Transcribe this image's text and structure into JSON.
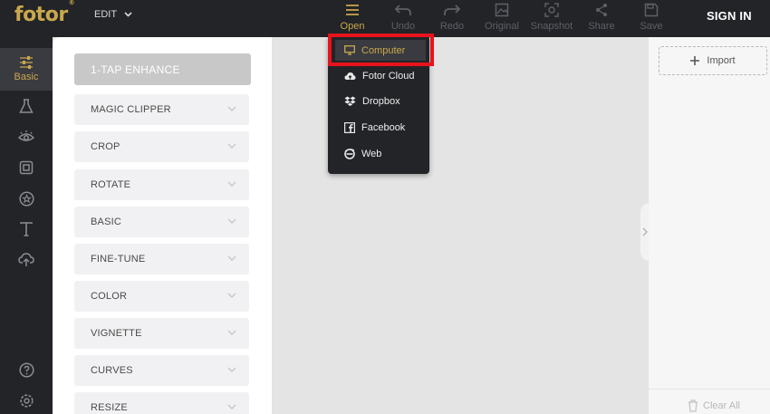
{
  "app": {
    "logo": "fotor",
    "logo_mark": "®",
    "mode_menu": "EDIT"
  },
  "toolbar": {
    "open": "Open",
    "undo": "Undo",
    "redo": "Redo",
    "original": "Original",
    "snapshot": "Snapshot",
    "share": "Share",
    "save": "Save",
    "sign_in": "SIGN IN"
  },
  "leftbar": {
    "active_label": "Basic"
  },
  "panel": {
    "enhance": "1-TAP ENHANCE",
    "items": [
      "MAGIC CLIPPER",
      "CROP",
      "ROTATE",
      "BASIC",
      "FINE-TUNE",
      "COLOR",
      "VIGNETTE",
      "CURVES",
      "RESIZE"
    ]
  },
  "open_menu": {
    "items": [
      "Computer",
      "Fotor Cloud",
      "Dropbox",
      "Facebook",
      "Web"
    ],
    "selected": "Computer"
  },
  "right_panel": {
    "import": "Import",
    "clear_all": "Clear All"
  },
  "colors": {
    "accent": "#c9a84c",
    "topbar": "#232428",
    "highlight": "#e8131c"
  }
}
